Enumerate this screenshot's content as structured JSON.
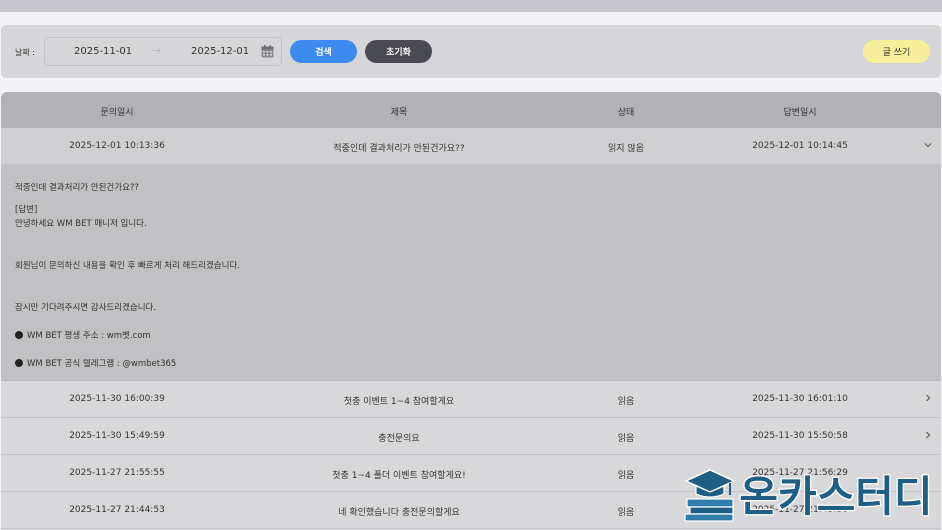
{
  "filter": {
    "date_label": "날짜 :",
    "start_date": "2025-11-01",
    "arrow": "→",
    "end_date": "2025-12-01",
    "search_label": "검색",
    "reset_label": "초기화",
    "write_label": "글 쓰기"
  },
  "table": {
    "headers": [
      "문의일시",
      "제목",
      "상태",
      "답변일시"
    ],
    "rows": [
      {
        "inquiry_time": "2025-12-01 10:13:36",
        "title": "적중인데 결과처리가 안된건가요??",
        "status": "읽지 않음",
        "answer_time": "2025-12-01 10:14:45",
        "expanded": true
      },
      {
        "inquiry_time": "2025-11-30 16:00:39",
        "title": "첫충 이벤트 1~4 참여할게요",
        "status": "읽음",
        "answer_time": "2025-11-30 16:01:10",
        "expanded": false
      },
      {
        "inquiry_time": "2025-11-30 15:49:59",
        "title": "충전문의요",
        "status": "읽음",
        "answer_time": "2025-11-30 15:50:58",
        "expanded": false
      },
      {
        "inquiry_time": "2025-11-27 21:55:55",
        "title": "첫충 1~4 폴더 이벤트 참여할게요!",
        "status": "읽음",
        "answer_time": "2025-11-27 21:56:29",
        "expanded": false
      },
      {
        "inquiry_time": "2025-11-27 21:44:53",
        "title": "네 확인했습니다 충전문의할게요",
        "status": "읽음",
        "answer_time": "2025-11-27 21:45:30",
        "expanded": false
      }
    ],
    "detail": {
      "question": "적중인데 결과처리가 안된건가요??",
      "answer_tag": "[답변]",
      "greeting": "안녕하세요 WM BET 매니저 입니다.",
      "body": "회원님이 문의하신 내용을 확인 후 빠르게 처리 해드리겠습니다.",
      "closing": "잠시만 기다려주시면 감사드리겠습니다.",
      "address": "WM BET 평생 주소 : wm벳.com",
      "telegram": "WM BET 공식 텔레그램 : @wmbet365"
    }
  },
  "watermark": {
    "text": "온카스터디"
  },
  "colors": {
    "primary": "#3d8bf0",
    "dark": "#4a4a52",
    "write": "#f7ef9a",
    "watermark": "#1f5f86"
  }
}
